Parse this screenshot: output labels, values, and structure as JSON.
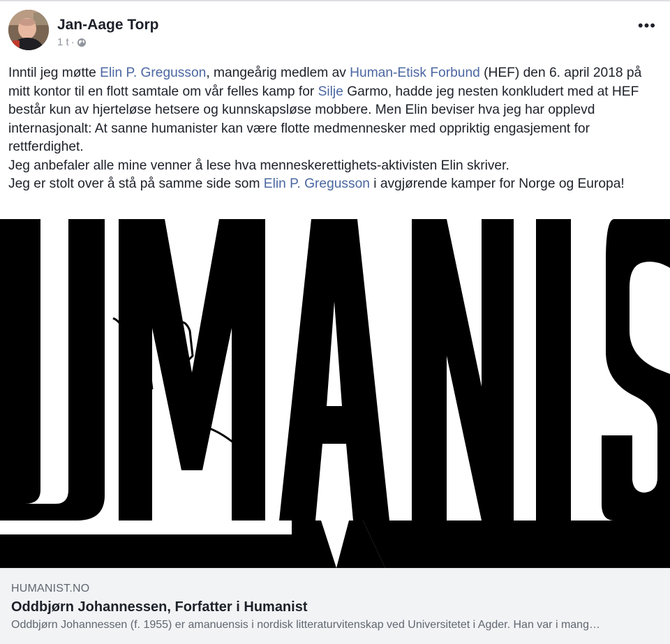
{
  "post": {
    "author": "Jan-Aage Torp",
    "timestamp": "1 t",
    "separator": "·",
    "privacy_icon": "globe-icon",
    "menu_icon": "more-options-icon",
    "menu_label": "•••",
    "paragraph1": {
      "t1": "Inntil jeg møtte ",
      "link1": "Elin P. Gregusson",
      "t2": ", mangeårig medlem av ",
      "link2": "Human-Etisk Forbund",
      "t3": " (HEF) den 6. april 2018 på mitt kontor til en flott samtale om vår felles kamp for ",
      "link3": "Silje",
      "t4": " Garmo, hadde jeg nesten konkludert med at HEF består kun av hjerteløse hetsere og kunnskapsløse mobbere. Men Elin beviser hva jeg har opplevd internasjonalt: At sanne humanister kan være flotte medmennesker med oppriktig engasjement for rettferdighet."
    },
    "paragraph2": "Jeg anbefaler alle mine venner å lese hva menneskerettighets-aktivisten Elin skriver.",
    "paragraph3": {
      "t1": "Jeg er stolt over å stå på samme side som ",
      "link1": "Elin P. Gregusson",
      "t2": " i avgjørende kamper for Norge og Europa!"
    },
    "link_color": "#4b67a1"
  },
  "image": {
    "graphic_text": "UMANIS"
  },
  "link_preview": {
    "domain": "HUMANIST.NO",
    "title": "Oddbjørn Johannessen, Forfatter i Humanist",
    "description": "Oddbjørn Johannessen (f. 1955) er amanuensis i nordisk litteraturvitenskap ved Universitetet i Agder. Han var i mang…"
  }
}
